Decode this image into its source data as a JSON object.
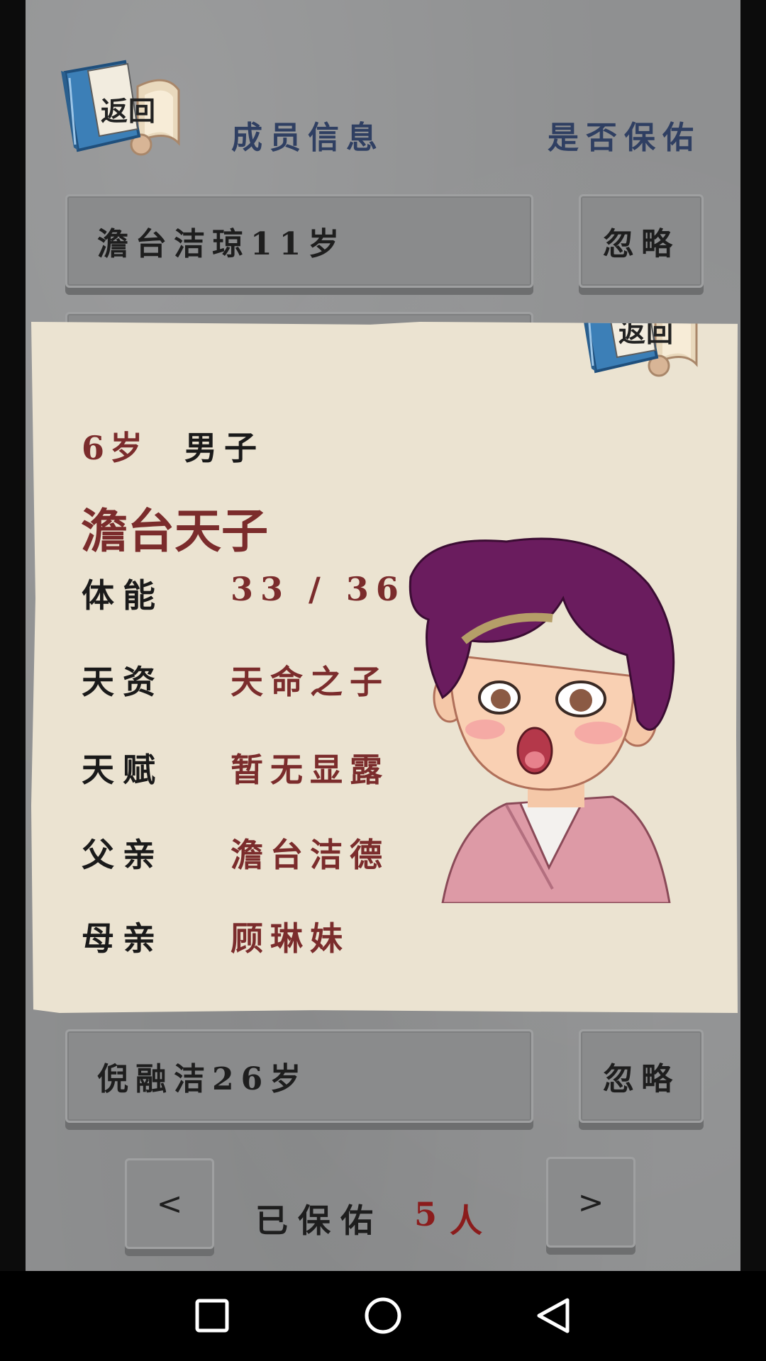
{
  "header": {
    "back_label": "返回",
    "title_left": "成员信息",
    "title_right": "是否保佑"
  },
  "rows": [
    {
      "name": "澹台洁琼11岁",
      "action": "忽略"
    },
    {
      "name": "倪融洁26岁",
      "action": "忽略"
    }
  ],
  "modal": {
    "back_label": "返回",
    "age": "6岁",
    "gender": "男子",
    "name": "澹台天子",
    "fields": [
      {
        "label": "体能",
        "value": "33 / 36"
      },
      {
        "label": "天资",
        "value": "天命之子"
      },
      {
        "label": "天赋",
        "value": "暂无显露"
      },
      {
        "label": "父亲",
        "value": "澹台洁德"
      },
      {
        "label": "母亲",
        "value": "顾琳妹"
      }
    ]
  },
  "footer": {
    "prev_label": "<",
    "next_label": ">",
    "blessed_label": "已保佑",
    "blessed_count": "5",
    "blessed_unit": "人"
  },
  "colors": {
    "accent_red": "#7b2c2c",
    "title_blue": "#2f3f62",
    "panel_bg": "#ebe3d1"
  },
  "icons": {
    "back": "book-scroll-icon",
    "system_recent": "square-icon",
    "system_home": "circle-icon",
    "system_back": "triangle-icon"
  }
}
